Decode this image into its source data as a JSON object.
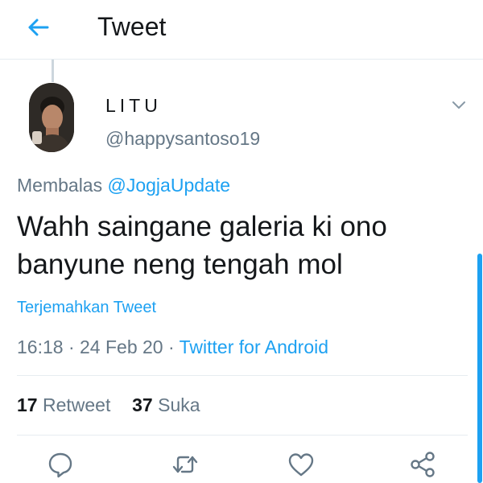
{
  "header": {
    "title": "Tweet",
    "back_icon": "arrow-left-icon"
  },
  "tweet": {
    "author": {
      "display_name": "LITU",
      "handle": "@happysantoso19"
    },
    "reply": {
      "prefix": "Membalas",
      "to": "@JogjaUpdate"
    },
    "text_line1": "Wahh saingane galeria ki ono",
    "text_line2": "banyune neng tengah mol",
    "translate_label": "Terjemahkan Tweet",
    "time": "16:18",
    "date": "24 Feb 20",
    "separator": "·",
    "client": "Twitter for Android"
  },
  "stats": {
    "retweets_count": "17",
    "retweets_label": "Retweet",
    "likes_count": "37",
    "likes_label": "Suka"
  },
  "actions": [
    "reply-icon",
    "retweet-icon",
    "like-icon",
    "share-icon"
  ],
  "colors": {
    "accent": "#1da1f2",
    "secondary_text": "#657786",
    "primary_text": "#14171a",
    "divider": "#e6ecf0"
  }
}
